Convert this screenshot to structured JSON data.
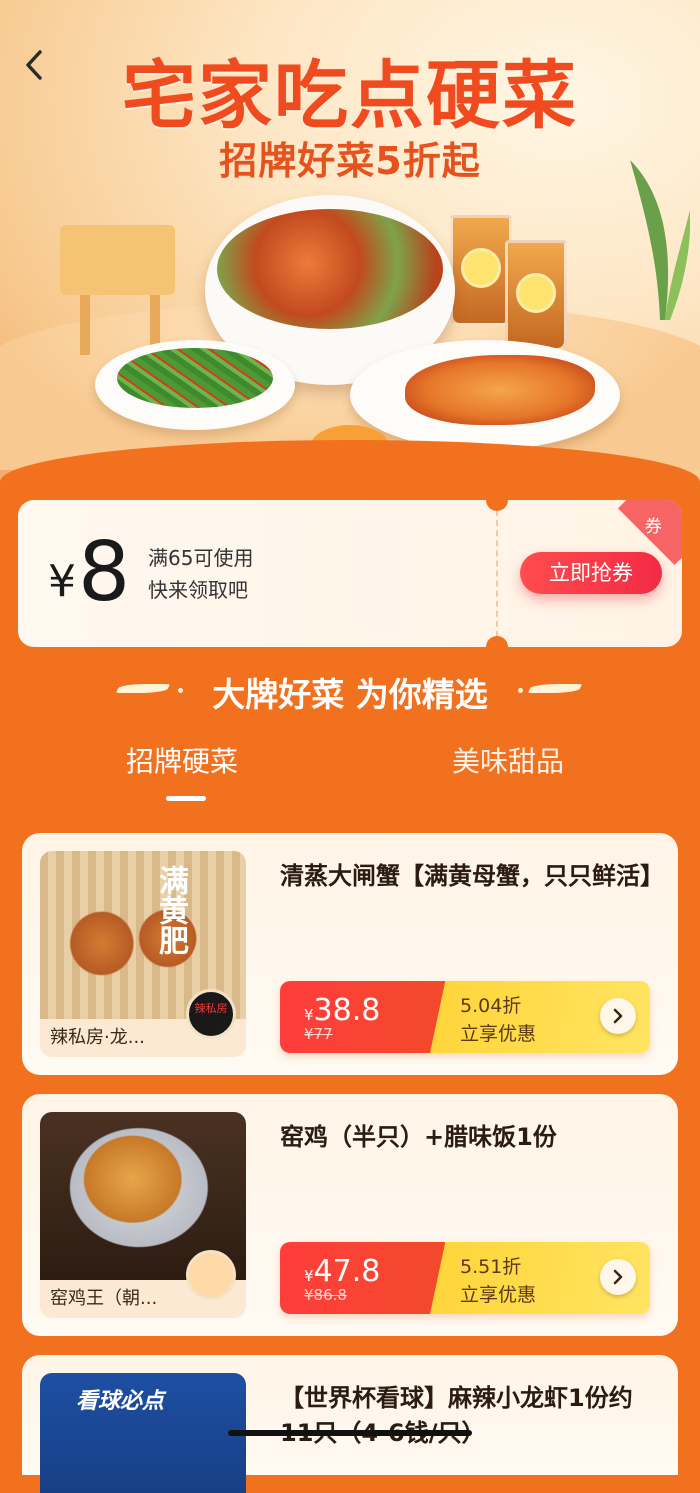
{
  "hero": {
    "title": "宅家吃点硬菜",
    "subtitle": "招牌好菜5折起",
    "back_icon": "chevron-left-icon"
  },
  "coupon": {
    "currency": "¥",
    "amount": "8",
    "condition": "满65可使用",
    "prompt": "快来领取吧",
    "button_label": "立即抢券",
    "corner_tag": "券"
  },
  "section": {
    "title": "大牌好菜 为你精选"
  },
  "tabs": [
    {
      "label": "招牌硬菜",
      "active": true
    },
    {
      "label": "美味甜品",
      "active": false
    }
  ],
  "products": [
    {
      "name": "清蒸大闸蟹【满黄母蟹，只只鲜活】",
      "shop": "辣私房·龙...",
      "image_text": "满黄肥",
      "badge": "辣私房",
      "currency": "¥",
      "price": "38.8",
      "original_price": "¥77",
      "discount": "5.04折",
      "action": "立享优惠"
    },
    {
      "name": "窑鸡（半只）+腊味饭1份",
      "shop": "窑鸡王（朝...",
      "currency": "¥",
      "price": "47.8",
      "original_price": "¥86.8",
      "discount": "5.51折",
      "action": "立享优惠"
    },
    {
      "name": "【世界杯看球】麻辣小龙虾1份约11只（4-6钱/只）",
      "image_text": "看球必点"
    }
  ],
  "colors": {
    "background": "#f2711e",
    "title_red": "#ef4b1f",
    "button_red": "#f22b44",
    "price_red": "#ff3d3d",
    "discount_yellow": "#ffd53b"
  }
}
